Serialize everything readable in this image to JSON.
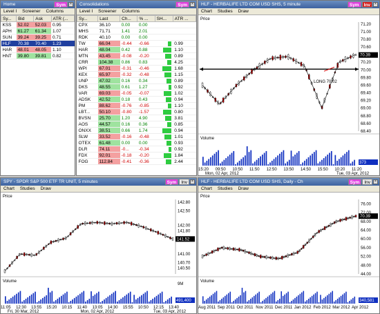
{
  "win_home": {
    "title": "Home",
    "sym": "Sym",
    "menu": [
      "Level I",
      "Screener",
      "Columns"
    ],
    "columns": [
      "Sy...",
      "Bid",
      "Ask",
      "ATR (..."
    ],
    "rows": [
      {
        "sym": "KSS",
        "bid": "52.02",
        "ask": "52.03",
        "atr": "0.95"
      },
      {
        "sym": "APH",
        "bid": "61.27",
        "ask": "61.34",
        "atr": "1.07"
      },
      {
        "sym": "SUN",
        "bid": "39.24",
        "ask": "39.25",
        "atr": "0.71"
      },
      {
        "sym": "HLF",
        "bid": "70.38",
        "ask": "70.40",
        "atr": "1.23"
      },
      {
        "sym": "HAR",
        "bid": "48.01",
        "ask": "48.05",
        "atr": "1.10"
      },
      {
        "sym": "HNT",
        "bid": "39.80",
        "ask": "39.81",
        "atr": "0.82"
      }
    ]
  },
  "win_cons": {
    "title": "Consolidations",
    "sym": "Sym",
    "menu": [
      "Level I",
      "Screener",
      "Columns"
    ],
    "columns": [
      "Sy...",
      "Last",
      "Ch...",
      "% ...",
      "SH...",
      "ATR ..."
    ],
    "rows": [
      {
        "sym": "CPX",
        "last": "36.10",
        "ch": "0.00",
        "pct": "0.00",
        "atr": ""
      },
      {
        "sym": "MHS",
        "last": "71.71",
        "ch": "1.41",
        "pct": "2.01",
        "atr": ""
      },
      {
        "sym": "RDK",
        "last": "40.10",
        "ch": "0.00",
        "pct": "0.00",
        "atr": ""
      },
      {
        "sym": "TW",
        "last": "66.04",
        "ch": "-0.44",
        "pct": "-0.66",
        "atr": "0.99"
      },
      {
        "sym": "HAR",
        "last": "48.04",
        "ch": "0.42",
        "pct": "0.88",
        "atr": "1.10"
      },
      {
        "sym": "MTN",
        "last": "43.45",
        "ch": "-0.08",
        "pct": "-0.20",
        "atr": "0.89"
      },
      {
        "sym": "CRR",
        "last": "104.38",
        "ch": "0.86",
        "pct": "0.83",
        "atr": "4.25"
      },
      {
        "sym": "WPI",
        "last": "67.01",
        "ch": "-0.31",
        "pct": "-0.46",
        "atr": "1.68"
      },
      {
        "sym": "KEX",
        "last": "65.97",
        "ch": "-0.32",
        "pct": "-0.48",
        "atr": "1.15"
      },
      {
        "sym": "UNP",
        "last": "47.02",
        "ch": "0.16",
        "pct": "0.34",
        "atr": "0.89"
      },
      {
        "sym": "DKS",
        "last": "48.55",
        "ch": "0.61",
        "pct": "1.27",
        "atr": "0.92"
      },
      {
        "sym": "VAR",
        "last": "69.03",
        "ch": "-0.05",
        "pct": "-0.07",
        "atr": "1.02"
      },
      {
        "sym": "ADSK",
        "last": "42.52",
        "ch": "0.18",
        "pct": "0.43",
        "atr": "0.94"
      },
      {
        "sym": "PM",
        "last": "88.62",
        "ch": "-0.76",
        "pct": "-0.85",
        "atr": "1.10"
      },
      {
        "sym": "LBT...",
        "last": "50.10",
        "ch": "-0.80",
        "pct": "-1.57",
        "atr": "0.80"
      },
      {
        "sym": "BVSN",
        "last": "25.70",
        "ch": "1.20",
        "pct": "4.90",
        "atr": "3.81"
      },
      {
        "sym": "AOS",
        "last": "44.57",
        "ch": "0.16",
        "pct": "0.36",
        "atr": "0.85"
      },
      {
        "sym": "ONXX",
        "last": "38.51",
        "ch": "0.66",
        "pct": "1.74",
        "atr": "0.94"
      },
      {
        "sym": "SLW",
        "last": "33.52",
        "ch": "-0.16",
        "pct": "-0.48",
        "atr": "1.01"
      },
      {
        "sym": "OTEX",
        "last": "61.48",
        "ch": "0.00",
        "pct": "0.00",
        "atr": "0.93"
      },
      {
        "sym": "DLR",
        "last": "74.11",
        "ch": "-0...",
        "pct": "-0.34",
        "atr": "0.92"
      },
      {
        "sym": "FDX",
        "last": "92.01",
        "ch": "-0.18",
        "pct": "-0.20",
        "atr": "1.84"
      },
      {
        "sym": "FOG",
        "last": "112.84",
        "ch": "-0.41",
        "pct": "-0.36",
        "atr": "2.44"
      }
    ]
  },
  "win_hlf5": {
    "title": "HLF - HERBALIFE LTD COM USD SHS, 5 minute",
    "sym": "Sym",
    "inv": "Inv",
    "menu": [
      "Chart",
      "Studies",
      "Draw"
    ],
    "price_label": "Price",
    "volume_label": "Volume",
    "annotation": "LONG 70.02",
    "last_price": "70.39",
    "last_volume": "373",
    "date_labels": [
      "Mon, 02 Apr, 2012",
      "Tue, 03 Apr, 2012"
    ],
    "chart_data": {
      "type": "line",
      "x": [
        "15:20",
        "09:50",
        "10:50",
        "11:50",
        "12:50",
        "13:50",
        "14:50",
        "15:50",
        "10:20",
        "11:20"
      ],
      "series": [
        {
          "values": [
            69.6,
            69.1,
            69.6,
            70.0,
            70.3,
            70.35,
            70.1,
            69.0,
            70.2,
            70.4
          ]
        }
      ],
      "ylim": [
        68.4,
        71.25
      ],
      "y_ticks": [
        "71.20",
        "71.00",
        "70.80",
        "70.60",
        "70.40",
        "70.20",
        "70.00",
        "69.80",
        "69.60",
        "69.40",
        "69.20",
        "69.00",
        "68.80",
        "68.60",
        "68.40"
      ],
      "hline": 70.02,
      "grid": false
    }
  },
  "win_spy": {
    "title": "SPY - SPDR S&P 500 ETF TR UNIT, 5 minutes",
    "sym": "Sym",
    "inv": "Inv",
    "menu": [
      "Chart",
      "Studies",
      "Draw"
    ],
    "price_label": "Price",
    "volume_label": "Volume",
    "last_price": "141.52",
    "last_volume": "491,400",
    "vol_top": "9M",
    "date_labels": [
      "Fri, 30 Mar, 2012",
      "Mon, 02 Apr, 2012",
      "Tue, 03 Apr, 2012"
    ],
    "chart_data": {
      "type": "line",
      "x": [
        "11:05",
        "12:30",
        "13:55",
        "15:20",
        "10:15",
        "11:40",
        "13:05",
        "14:30",
        "15:55",
        "10:50",
        "12:15",
        "13:40"
      ],
      "series": [
        {
          "values": [
            140.4,
            141.0,
            140.95,
            141.4,
            141.55,
            142.05,
            142.1,
            142.05,
            142.1,
            141.95,
            141.75,
            141.52
          ]
        }
      ],
      "ylim": [
        140.3,
        142.9
      ],
      "y_ticks": [
        "142.80",
        "142.50",
        "142.00",
        "141.80",
        "141.52",
        "141.00",
        "140.70",
        "140.50"
      ],
      "grid": false
    }
  },
  "win_hlfd": {
    "title": "HLF - HERBALIFE LTD COM USD SHS, Daily - Ch",
    "sym": "Sym",
    "inv": "Inv",
    "menu": [
      "Chart",
      "Studies",
      "Draw"
    ],
    "price_label": "Price",
    "volume_label": "Volume",
    "last_price": "70.39",
    "last_volume": "340,581",
    "date_labels": [
      "Aug 2011",
      "Sep 2011",
      "Oct 2011",
      "Nov 2011",
      "Dec 2011",
      "Jan 2012",
      "Feb 2012",
      "Mar 2012",
      "Apr 2012"
    ],
    "chart_data": {
      "type": "line",
      "x": [
        "Aug 2011",
        "Sep 2011",
        "Oct 2011",
        "Nov 2011",
        "Dec 2011",
        "Jan 2012",
        "Feb 2012",
        "Mar 2012",
        "Apr 2012"
      ],
      "series": [
        {
          "values": [
            52.0,
            56.0,
            55.0,
            52.0,
            51.0,
            54.0,
            63.0,
            68.0,
            70.4
          ]
        }
      ],
      "ylim": [
        44.0,
        78.0
      ],
      "y_ticks": [
        "76.00",
        "72.00",
        "68.00",
        "64.00",
        "60.00",
        "56.00",
        "52.00",
        "48.00",
        "44.00"
      ],
      "grid": false
    }
  }
}
